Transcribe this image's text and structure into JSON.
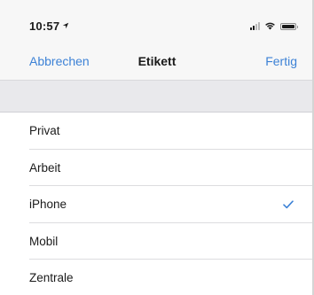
{
  "status_bar": {
    "time": "10:57",
    "location_icon": "location-arrow-icon",
    "signal_icon": "signal-bars-icon",
    "wifi_icon": "wifi-icon",
    "battery_icon": "battery-icon"
  },
  "nav": {
    "cancel_label": "Abbrechen",
    "title": "Etikett",
    "done_label": "Fertig"
  },
  "colors": {
    "accent": "#3d82d6",
    "text": "#1a1a1a",
    "band": "#e9e9ec"
  },
  "list": {
    "items": [
      {
        "label": "Privat",
        "selected": false
      },
      {
        "label": "Arbeit",
        "selected": false
      },
      {
        "label": "iPhone",
        "selected": true
      },
      {
        "label": "Mobil",
        "selected": false
      },
      {
        "label": "Zentrale",
        "selected": false
      }
    ],
    "check_icon": "checkmark-icon"
  }
}
